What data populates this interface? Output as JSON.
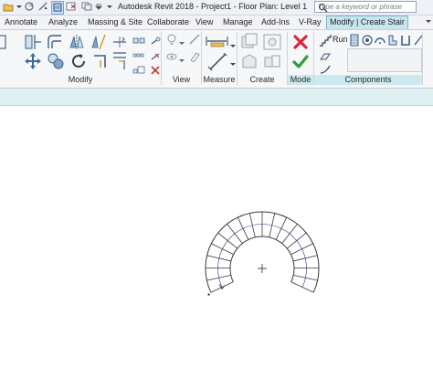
{
  "app": {
    "title": "Autodesk Revit 2018 -  Project1 - Floor Plan: Level 1",
    "search_placeholder": "Type a keyword or phrase"
  },
  "tabs": [
    {
      "label": "Annotate"
    },
    {
      "label": "Analyze"
    },
    {
      "label": "Massing & Site"
    },
    {
      "label": "Collaborate"
    },
    {
      "label": "View"
    },
    {
      "label": "Manage"
    },
    {
      "label": "Add-Ins"
    },
    {
      "label": "V-Ray"
    },
    {
      "label": "Modify | Create Stair",
      "active": true
    }
  ],
  "panels": {
    "modify": "Modify",
    "view": "View",
    "measure": "Measure",
    "create": "Create",
    "mode": "Mode",
    "components": "Components"
  },
  "components": {
    "run_label": "Run"
  },
  "colors": {
    "accent": "#c9e6ee",
    "finish_check": "#2e9d3a",
    "cancel_x": "#d7263d",
    "stair_line": "#3a3a3a",
    "stair_arrow": "#2b2b8f"
  }
}
